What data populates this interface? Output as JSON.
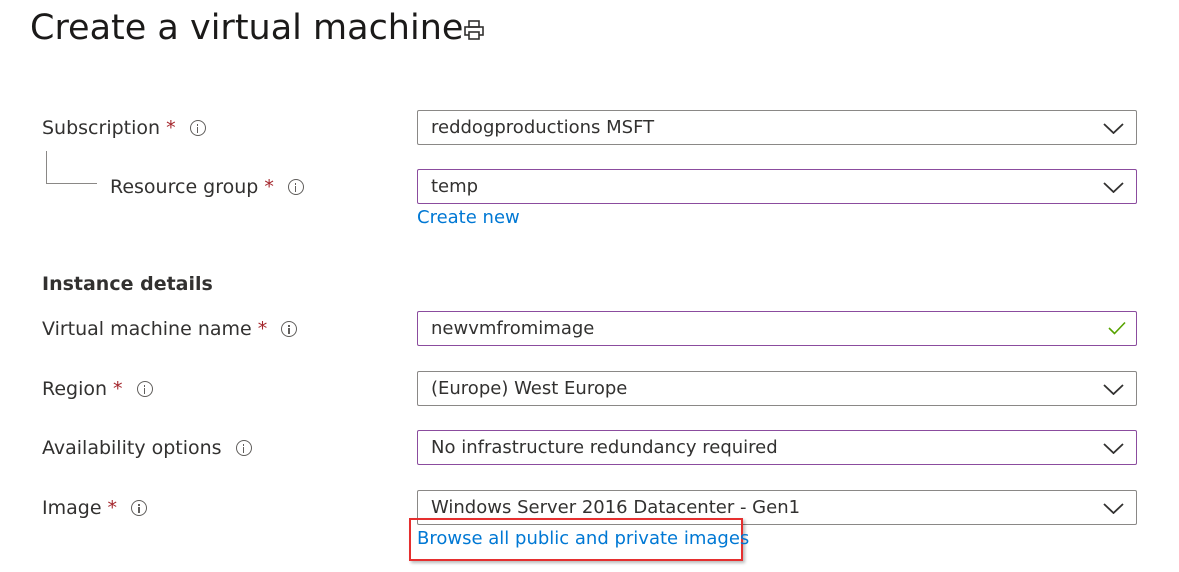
{
  "page": {
    "title": "Create a virtual machine",
    "print_icon": "print-icon"
  },
  "subscription": {
    "label": "Subscription",
    "required_marker": "*",
    "value": "reddogproductions MSFT"
  },
  "resource_group": {
    "label": "Resource group",
    "required_marker": "*",
    "value": "temp",
    "create_new_link": "Create new"
  },
  "instance_details": {
    "heading": "Instance details"
  },
  "vm_name": {
    "label": "Virtual machine name",
    "required_marker": "*",
    "value": "newvmfromimage",
    "valid": true
  },
  "region": {
    "label": "Region",
    "required_marker": "*",
    "value": "(Europe) West Europe"
  },
  "availability": {
    "label": "Availability options",
    "value": "No infrastructure redundancy required"
  },
  "image": {
    "label": "Image",
    "required_marker": "*",
    "value": "Windows Server 2016 Datacenter - Gen1",
    "browse_link": "Browse all public and private images"
  },
  "colors": {
    "accent_link": "#0078d4",
    "focus_border": "#8b4c9e",
    "required": "#a4262c",
    "valid_check": "#57a300",
    "highlight": "#e52f2f"
  }
}
